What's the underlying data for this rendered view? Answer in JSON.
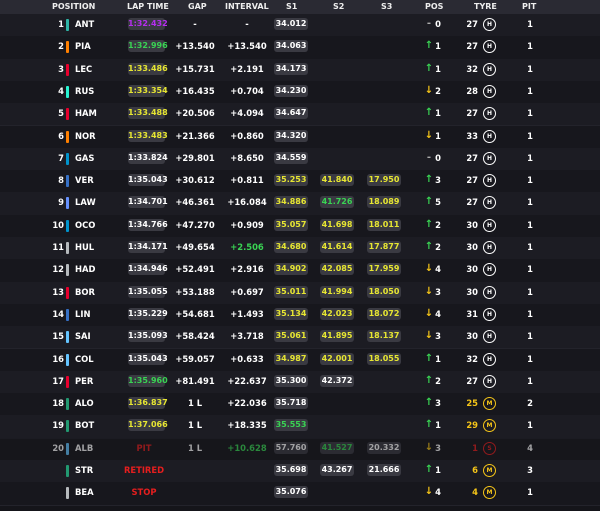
{
  "headers": {
    "position": "POSITION",
    "lap_time": "LAP TIME",
    "gap": "GAP",
    "interval": "INTERVAL",
    "s1": "S1",
    "s2": "S2",
    "s3": "S3",
    "pos": "POS",
    "tyre": "TYRE",
    "pit": "PIT"
  },
  "colors": {
    "purple": "#b62ef0",
    "green": "#39d353",
    "yellow": "#e7e632",
    "white": "#ffffff",
    "red": "#e61e1e",
    "up": "#39d353",
    "down": "#f5c518"
  },
  "rows": [
    {
      "pos": "1",
      "team": "#2fb5a7",
      "driver": "ANT",
      "lap": "1:32.432",
      "lapc": "purple",
      "gap": "-",
      "int": "-",
      "s1": "34.012",
      "s1c": "white",
      "s2": "",
      "s2c": "",
      "s3": "",
      "s3c": "",
      "dir": "same",
      "chg": "0",
      "laps": "27",
      "tyre": "H",
      "tyrec": "#ffffff",
      "pit": "1"
    },
    {
      "pos": "2",
      "team": "#ff8000",
      "driver": "PIA",
      "lap": "1:32.996",
      "lapc": "green",
      "gap": "+13.540",
      "int": "+13.540",
      "s1": "34.063",
      "s1c": "white",
      "s2": "",
      "s2c": "",
      "s3": "",
      "s3c": "",
      "dir": "up",
      "chg": "1",
      "laps": "27",
      "tyre": "H",
      "tyrec": "#ffffff",
      "pit": "1"
    },
    {
      "pos": "3",
      "team": "#e8002d",
      "driver": "LEC",
      "lap": "1:33.486",
      "lapc": "yellow",
      "gap": "+15.731",
      "int": "+2.191",
      "s1": "34.173",
      "s1c": "white",
      "s2": "",
      "s2c": "",
      "s3": "",
      "s3c": "",
      "dir": "up",
      "chg": "1",
      "laps": "32",
      "tyre": "H",
      "tyrec": "#ffffff",
      "pit": "1"
    },
    {
      "pos": "4",
      "team": "#27f4d2",
      "driver": "RUS",
      "lap": "1:33.354",
      "lapc": "yellow",
      "gap": "+16.435",
      "int": "+0.704",
      "s1": "34.230",
      "s1c": "white",
      "s2": "",
      "s2c": "",
      "s3": "",
      "s3c": "",
      "dir": "down",
      "chg": "2",
      "laps": "28",
      "tyre": "H",
      "tyrec": "#ffffff",
      "pit": "1"
    },
    {
      "pos": "5",
      "team": "#e8002d",
      "driver": "HAM",
      "lap": "1:33.488",
      "lapc": "yellow",
      "gap": "+20.506",
      "int": "+4.094",
      "s1": "34.647",
      "s1c": "white",
      "s2": "",
      "s2c": "",
      "s3": "",
      "s3c": "",
      "dir": "up",
      "chg": "1",
      "laps": "27",
      "tyre": "H",
      "tyrec": "#ffffff",
      "pit": "1"
    },
    {
      "pos": "6",
      "team": "#ff8000",
      "driver": "NOR",
      "lap": "1:33.483",
      "lapc": "yellow",
      "gap": "+21.366",
      "int": "+0.860",
      "s1": "34.320",
      "s1c": "white",
      "s2": "",
      "s2c": "",
      "s3": "",
      "s3c": "",
      "dir": "down",
      "chg": "1",
      "laps": "33",
      "tyre": "H",
      "tyrec": "#ffffff",
      "pit": "1"
    },
    {
      "pos": "7",
      "team": "#0093cc",
      "driver": "GAS",
      "lap": "1:33.824",
      "lapc": "white",
      "gap": "+29.801",
      "int": "+8.650",
      "s1": "34.559",
      "s1c": "white",
      "s2": "",
      "s2c": "",
      "s3": "",
      "s3c": "",
      "dir": "same",
      "chg": "0",
      "laps": "27",
      "tyre": "H",
      "tyrec": "#ffffff",
      "pit": "1"
    },
    {
      "pos": "8",
      "team": "#3671c6",
      "driver": "VER",
      "lap": "1:35.043",
      "lapc": "white",
      "gap": "+30.612",
      "int": "+0.811",
      "s1": "35.253",
      "s1c": "yellow",
      "s2": "41.840",
      "s2c": "yellow",
      "s3": "17.950",
      "s3c": "yellow",
      "dir": "up",
      "chg": "3",
      "laps": "27",
      "tyre": "H",
      "tyrec": "#ffffff",
      "pit": "1"
    },
    {
      "pos": "9",
      "team": "#6692ff",
      "driver": "LAW",
      "lap": "1:34.701",
      "lapc": "white",
      "gap": "+46.361",
      "int": "+16.084",
      "s1": "34.886",
      "s1c": "yellow",
      "s2": "41.726",
      "s2c": "green",
      "s3": "18.089",
      "s3c": "yellow",
      "dir": "up",
      "chg": "5",
      "laps": "27",
      "tyre": "H",
      "tyrec": "#ffffff",
      "pit": "1"
    },
    {
      "pos": "10",
      "team": "#0093cc",
      "driver": "OCO",
      "lap": "1:34.766",
      "lapc": "white",
      "gap": "+47.270",
      "int": "+0.909",
      "s1": "35.057",
      "s1c": "yellow",
      "s2": "41.698",
      "s2c": "yellow",
      "s3": "18.011",
      "s3c": "yellow",
      "dir": "up",
      "chg": "2",
      "laps": "30",
      "tyre": "H",
      "tyrec": "#ffffff",
      "pit": "1"
    },
    {
      "pos": "11",
      "team": "#b6babd",
      "driver": "HUL",
      "lap": "1:34.171",
      "lapc": "white",
      "gap": "+49.654",
      "int": "+2.506",
      "intc": "green",
      "s1": "34.680",
      "s1c": "yellow",
      "s2": "41.614",
      "s2c": "yellow",
      "s3": "17.877",
      "s3c": "yellow",
      "dir": "up",
      "chg": "2",
      "laps": "30",
      "tyre": "H",
      "tyrec": "#ffffff",
      "pit": "1"
    },
    {
      "pos": "12",
      "team": "#b6babd",
      "driver": "HAD",
      "lap": "1:34.946",
      "lapc": "white",
      "gap": "+52.491",
      "int": "+2.916",
      "s1": "34.902",
      "s1c": "yellow",
      "s2": "42.085",
      "s2c": "yellow",
      "s3": "17.959",
      "s3c": "yellow",
      "dir": "down",
      "chg": "4",
      "laps": "30",
      "tyre": "H",
      "tyrec": "#ffffff",
      "pit": "1"
    },
    {
      "pos": "13",
      "team": "#e8002d",
      "driver": "BOR",
      "lap": "1:35.055",
      "lapc": "white",
      "gap": "+53.188",
      "int": "+0.697",
      "s1": "35.011",
      "s1c": "yellow",
      "s2": "41.994",
      "s2c": "yellow",
      "s3": "18.050",
      "s3c": "yellow",
      "dir": "down",
      "chg": "3",
      "laps": "30",
      "tyre": "H",
      "tyrec": "#ffffff",
      "pit": "1"
    },
    {
      "pos": "14",
      "team": "#3671c6",
      "driver": "LIN",
      "lap": "1:35.229",
      "lapc": "white",
      "gap": "+54.681",
      "int": "+1.493",
      "s1": "35.134",
      "s1c": "yellow",
      "s2": "42.023",
      "s2c": "yellow",
      "s3": "18.072",
      "s3c": "yellow",
      "dir": "down",
      "chg": "4",
      "laps": "31",
      "tyre": "H",
      "tyrec": "#ffffff",
      "pit": "1"
    },
    {
      "pos": "15",
      "team": "#64c4ff",
      "driver": "SAI",
      "lap": "1:35.093",
      "lapc": "white",
      "gap": "+58.424",
      "int": "+3.718",
      "s1": "35.061",
      "s1c": "yellow",
      "s2": "41.895",
      "s2c": "yellow",
      "s3": "18.137",
      "s3c": "yellow",
      "dir": "down",
      "chg": "3",
      "laps": "30",
      "tyre": "H",
      "tyrec": "#ffffff",
      "pit": "1"
    },
    {
      "pos": "16",
      "team": "#64c4ff",
      "driver": "COL",
      "lap": "1:35.043",
      "lapc": "white",
      "gap": "+59.057",
      "int": "+0.633",
      "s1": "34.987",
      "s1c": "yellow",
      "s2": "42.001",
      "s2c": "yellow",
      "s3": "18.055",
      "s3c": "yellow",
      "dir": "up",
      "chg": "1",
      "laps": "32",
      "tyre": "H",
      "tyrec": "#ffffff",
      "pit": "1"
    },
    {
      "pos": "17",
      "team": "#e8002d",
      "driver": "PER",
      "lap": "1:35.960",
      "lapc": "green",
      "gap": "+81.491",
      "int": "+22.637",
      "s1": "35.300",
      "s1c": "white",
      "s2": "42.372",
      "s2c": "white",
      "s3": "",
      "s3c": "",
      "dir": "up",
      "chg": "2",
      "laps": "27",
      "tyre": "H",
      "tyrec": "#ffffff",
      "pit": "1"
    },
    {
      "pos": "18",
      "team": "#229971",
      "driver": "ALO",
      "lap": "1:36.837",
      "lapc": "yellow",
      "gap": "1 L",
      "int": "+22.036",
      "s1": "35.718",
      "s1c": "white",
      "s2": "",
      "s2c": "",
      "s3": "",
      "s3c": "",
      "dir": "up",
      "chg": "3",
      "laps": "25",
      "lapsc": "#f5c518",
      "tyre": "M",
      "tyrec": "#f5c518",
      "pit": "2"
    },
    {
      "pos": "19",
      "team": "#229971",
      "driver": "BOT",
      "lap": "1:37.066",
      "lapc": "yellow",
      "gap": "1 L",
      "int": "+18.335",
      "s1": "35.553",
      "s1c": "green",
      "s2": "",
      "s2c": "",
      "s3": "",
      "s3c": "",
      "dir": "up",
      "chg": "1",
      "laps": "29",
      "lapsc": "#f5c518",
      "tyre": "M",
      "tyrec": "#f5c518",
      "pit": "1"
    },
    {
      "pos": "20",
      "team": "#64c4ff",
      "driver": "ALB",
      "status": "PIT",
      "gap": "1 L",
      "int": "+10.628",
      "intc": "green",
      "s1": "57.760",
      "s1c": "white",
      "s2": "41.527",
      "s2c": "green",
      "s3": "20.332",
      "s3c": "white",
      "dir": "down",
      "chg": "3",
      "laps": "1",
      "lapsc": "#e61e1e",
      "tyre": "S",
      "tyrec": "#e61e1e",
      "pit": "4",
      "dim": true
    },
    {
      "pos": "",
      "team": "#229971",
      "driver": "STR",
      "status": "RETIRED",
      "gap": "",
      "int": "",
      "s1": "35.698",
      "s1c": "white",
      "s2": "43.267",
      "s2c": "white",
      "s3": "21.666",
      "s3c": "white",
      "dir": "up",
      "chg": "1",
      "laps": "6",
      "lapsc": "#f5c518",
      "tyre": "M",
      "tyrec": "#f5c518",
      "pit": "3"
    },
    {
      "pos": "",
      "team": "#b6babd",
      "driver": "BEA",
      "status": "STOP",
      "gap": "",
      "int": "",
      "s1": "35.076",
      "s1c": "white",
      "s2": "",
      "s2c": "",
      "s3": "",
      "s3c": "",
      "dir": "down",
      "chg": "4",
      "laps": "4",
      "lapsc": "#f5c518",
      "tyre": "M",
      "tyrec": "#f5c518",
      "pit": "1"
    }
  ]
}
